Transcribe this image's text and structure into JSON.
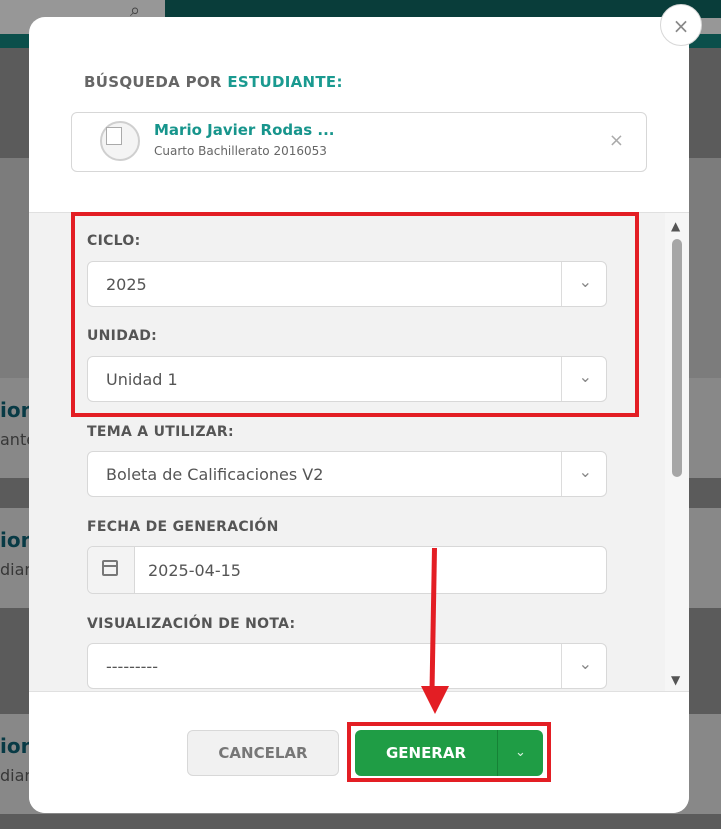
{
  "background": {
    "items": [
      {
        "title": "ion",
        "sub": "ante"
      },
      {
        "title": "ion",
        "sub": "dian"
      },
      {
        "title": "ion",
        "sub": "dian"
      }
    ]
  },
  "modal": {
    "close_icon": "×",
    "search_title_prefix": "BÚSQUEDA POR",
    "search_title_accent": "ESTUDIANTE:",
    "student": {
      "name": "Mario Javier Rodas ...",
      "detail": "Cuarto Bachillerato 2016053",
      "clear_icon": "×"
    },
    "fields": {
      "ciclo": {
        "label": "CICLO:",
        "value": "2025"
      },
      "unidad": {
        "label": "UNIDAD:",
        "value": "Unidad 1"
      },
      "tema": {
        "label": "TEMA A UTILIZAR:",
        "value": "Boleta de Calificaciones V2"
      },
      "fecha": {
        "label": "FECHA DE GENERACIÓN",
        "value": "2025-04-15"
      },
      "visualizacion": {
        "label": "VISUALIZACIÓN DE NOTA:",
        "value": "---------"
      }
    },
    "chevron": "⌄",
    "scroll_up": "▲",
    "scroll_down": "▼",
    "buttons": {
      "cancel": "CANCELAR",
      "generate": "GENERAR",
      "generate_caret": "⌄"
    }
  },
  "colors": {
    "accent_teal": "#1a9a90",
    "generate_green": "#1f9d45",
    "annotation_red": "#e31e24"
  }
}
